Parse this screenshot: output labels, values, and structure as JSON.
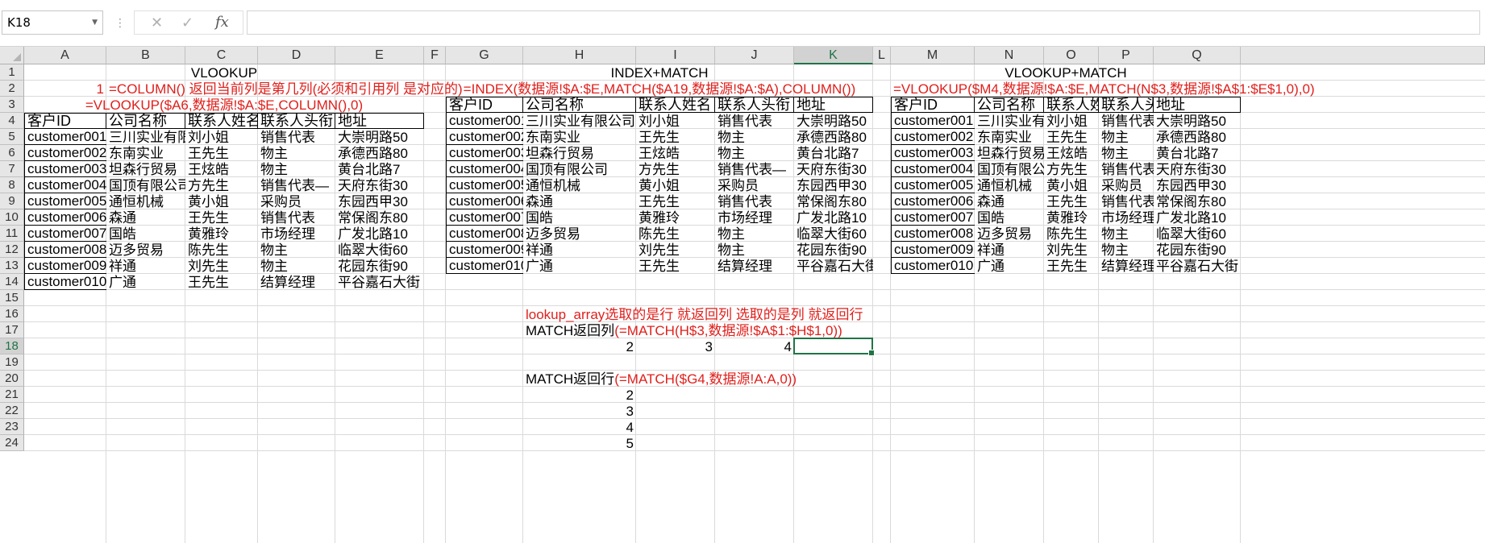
{
  "formula_bar": {
    "name_box": "K18",
    "cancel_icon": "✕",
    "enter_icon": "✓",
    "fx_label": "fx",
    "formula": ""
  },
  "columns": [
    "A",
    "B",
    "C",
    "D",
    "E",
    "F",
    "G",
    "H",
    "I",
    "J",
    "K",
    "L",
    "M",
    "N",
    "O",
    "P",
    "Q"
  ],
  "rows": [
    "1",
    "2",
    "3",
    "4",
    "5",
    "6",
    "7",
    "8",
    "9",
    "10",
    "11",
    "12",
    "13",
    "14",
    "15",
    "16",
    "17",
    "18",
    "19",
    "20",
    "21",
    "22",
    "23",
    "24"
  ],
  "selected": {
    "column": "K",
    "row": "18"
  },
  "colors": {
    "accent": "#217346",
    "formula_red": "#e0201c"
  },
  "sections": {
    "vlookup": {
      "title": "VLOOKUP",
      "note_num": "1",
      "note_text": "=COLUMN() 返回当前列是第几列(必须和引用列 是对应的)",
      "formula": "=VLOOKUP($A6,数据源!$A:$E,COLUMN(),0)"
    },
    "index_match": {
      "title": "INDEX+MATCH",
      "formula": "=INDEX(数据源!$A:$E,MATCH($A19,数据源!$A:$A),COLUMN())"
    },
    "vlookup_match": {
      "title": "VLOOKUP+MATCH",
      "formula": "=VLOOKUP($M4,数据源!$A:$E,MATCH(N$3,数据源!$A$1:$E$1,0),0)"
    }
  },
  "headers": [
    "客户ID",
    "公司名称",
    "联系人姓名",
    "联系人头衔",
    "地址"
  ],
  "table": [
    [
      "customer001",
      "三川实业有限公司",
      "刘小姐",
      "销售代表",
      "大崇明路50"
    ],
    [
      "customer002",
      "东南实业",
      "王先生",
      "物主",
      "承德西路80"
    ],
    [
      "customer003",
      "坦森行贸易",
      "王炫皓",
      "物主",
      "黄台北路7"
    ],
    [
      "customer004",
      "国顶有限公司",
      "方先生",
      "销售代表—",
      "天府东街30"
    ],
    [
      "customer005",
      "通恒机械",
      "黄小姐",
      "采购员",
      "东园西甲30"
    ],
    [
      "customer006",
      "森通",
      "王先生",
      "销售代表",
      "常保阁东80"
    ],
    [
      "customer007",
      "国皓",
      "黄雅玲",
      "市场经理",
      "广发北路10"
    ],
    [
      "customer008",
      "迈多贸易",
      "陈先生",
      "物主",
      "临翠大街60"
    ],
    [
      "customer009",
      "祥通",
      "刘先生",
      "物主",
      "花园东街90"
    ],
    [
      "customer010",
      "广通",
      "王先生",
      "结算经理",
      "平谷嘉石大街"
    ]
  ],
  "notes": {
    "lookup_note": "lookup_array选取的是行 就返回列    选取的是列 就返回行",
    "match_col_label": "MATCH返回列",
    "match_col_formula": "(=MATCH(H$3,数据源!$A$1:$H$1,0))",
    "match_col_values": [
      "2",
      "3",
      "4"
    ],
    "match_row_label": "MATCH返回行",
    "match_row_formula": "(=MATCH($G4,数据源!A:A,0))",
    "match_row_values": [
      "2",
      "3",
      "4",
      "5"
    ]
  }
}
